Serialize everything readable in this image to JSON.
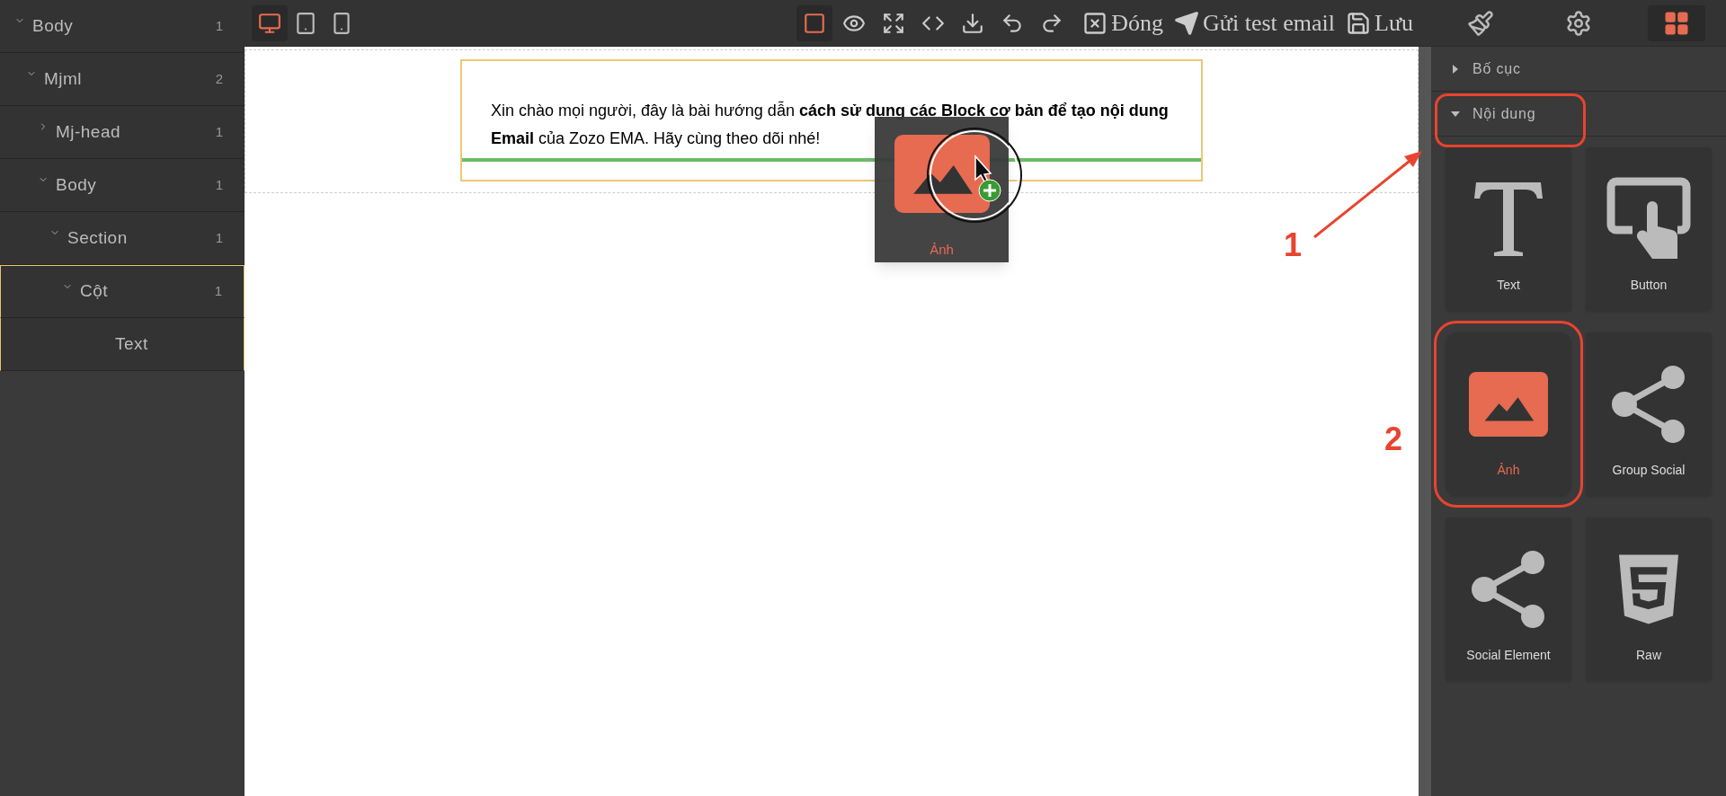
{
  "layer_tree": [
    {
      "label": "Body",
      "count": "1",
      "expanded": true,
      "selected": false,
      "children": [
        {
          "label": "Mjml",
          "count": "2",
          "expanded": true,
          "selected": false,
          "children": [
            {
              "label": "Mj-head",
              "count": "1",
              "expanded": false,
              "selected": false
            },
            {
              "label": "Body",
              "count": "1",
              "expanded": true,
              "selected": false,
              "children": [
                {
                  "label": "Section",
                  "count": "1",
                  "expanded": true,
                  "selected": false,
                  "children": [
                    {
                      "label": "Cột",
                      "count": "1",
                      "expanded": true,
                      "selected": true,
                      "children": [
                        {
                          "label": "Text",
                          "selected": false
                        }
                      ]
                    }
                  ]
                }
              ]
            }
          ]
        }
      ]
    }
  ],
  "toolbar": {
    "devices": [
      {
        "kind": "desktop",
        "selected": true
      },
      {
        "kind": "tablet",
        "selected": false
      },
      {
        "kind": "mobile",
        "selected": false
      }
    ],
    "tools": [
      {
        "kind": "outline",
        "active": true
      },
      {
        "kind": "preview",
        "active": false
      },
      {
        "kind": "fullscreen",
        "active": false
      },
      {
        "kind": "code",
        "active": false
      },
      {
        "kind": "export",
        "active": false
      },
      {
        "kind": "undo",
        "active": false
      },
      {
        "kind": "redo",
        "active": false
      }
    ],
    "text_actions": [
      {
        "kind": "close",
        "label": "Đóng"
      },
      {
        "kind": "send",
        "label": "Gửi test email"
      },
      {
        "kind": "save",
        "label": "Lưu"
      }
    ]
  },
  "canvas": {
    "text": "Xin chào mọi người, đây là bài hướng dẫn **cách sử dụng các Block cơ bản để tạo nội dung Email** của Zozo EMA. Hãy cùng theo dõi nhé!"
  },
  "drag_ghost": {
    "label": "Ảnh"
  },
  "panel_tabs": [
    {
      "kind": "style",
      "selected": false
    },
    {
      "kind": "settings",
      "selected": false
    },
    {
      "kind": "blocks",
      "selected": true
    }
  ],
  "categories": [
    {
      "label": "Bố cục",
      "expanded": false,
      "highlighted": false
    },
    {
      "label": "Nội dung",
      "expanded": true,
      "highlighted": true
    }
  ],
  "blocks": [
    {
      "kind": "text",
      "label": "Text",
      "highlighted": false
    },
    {
      "kind": "button",
      "label": "Button",
      "highlighted": false
    },
    {
      "kind": "image",
      "label": "Ảnh",
      "highlighted": true
    },
    {
      "kind": "share",
      "label": "Group Social",
      "highlighted": false
    },
    {
      "kind": "share",
      "label": "Social Element",
      "highlighted": false
    },
    {
      "kind": "html",
      "label": "Raw",
      "highlighted": false
    }
  ],
  "annotations": [
    {
      "label": "1"
    },
    {
      "label": "2"
    }
  ]
}
